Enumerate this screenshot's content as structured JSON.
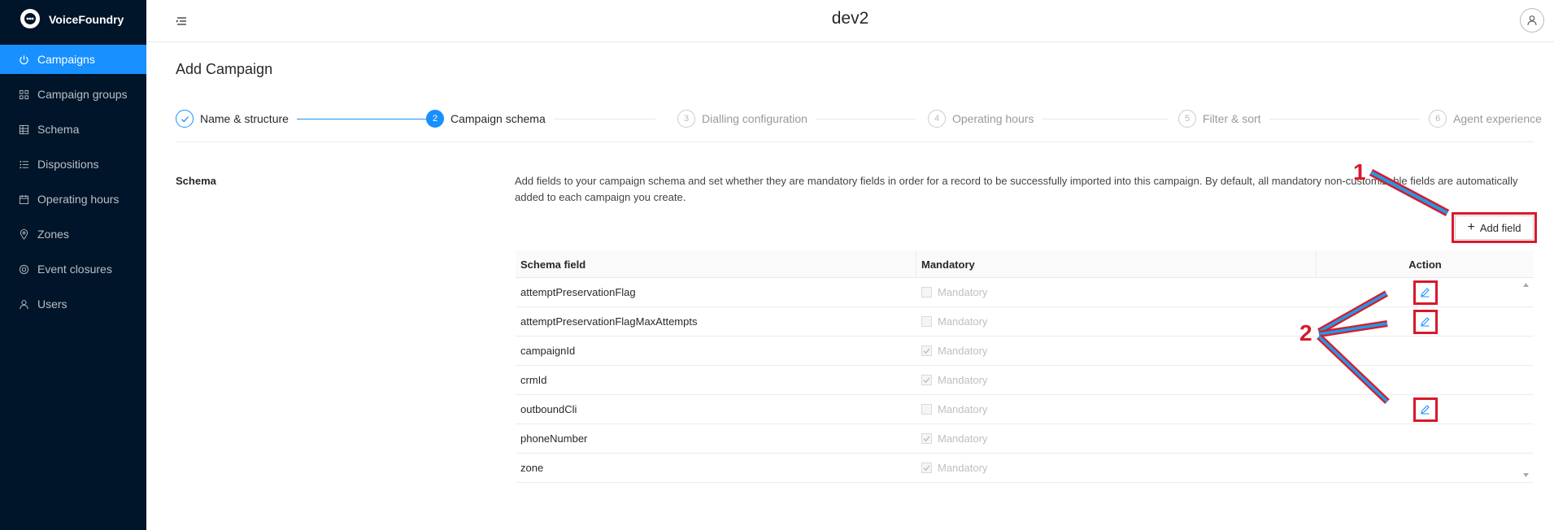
{
  "app": {
    "brand": "VoiceFoundry",
    "title": "dev2"
  },
  "sidebar": {
    "items": [
      {
        "label": "Campaigns",
        "icon": "power-icon",
        "active": true
      },
      {
        "label": "Campaign groups",
        "icon": "group-icon",
        "active": false
      },
      {
        "label": "Schema",
        "icon": "table-icon",
        "active": false
      },
      {
        "label": "Dispositions",
        "icon": "list-icon",
        "active": false
      },
      {
        "label": "Operating hours",
        "icon": "calendar-icon",
        "active": false
      },
      {
        "label": "Zones",
        "icon": "location-icon",
        "active": false
      },
      {
        "label": "Event closures",
        "icon": "target-icon",
        "active": false
      },
      {
        "label": "Users",
        "icon": "user-icon",
        "active": false
      }
    ]
  },
  "page": {
    "title": "Add Campaign"
  },
  "steps": [
    {
      "num": "1",
      "label": "Name & structure",
      "state": "done"
    },
    {
      "num": "2",
      "label": "Campaign schema",
      "state": "active"
    },
    {
      "num": "3",
      "label": "Dialling configuration",
      "state": "pending"
    },
    {
      "num": "4",
      "label": "Operating hours",
      "state": "pending"
    },
    {
      "num": "5",
      "label": "Filter & sort",
      "state": "pending"
    },
    {
      "num": "6",
      "label": "Agent experience",
      "state": "pending"
    }
  ],
  "schema": {
    "section_label": "Schema",
    "description": "Add fields to your campaign schema and set whether they are mandatory fields in order for a record to be successfully imported into this campaign. By default, all mandatory non-customizable fields are automatically added to each campaign you create.",
    "add_button": "Add field",
    "columns": [
      "Schema field",
      "Mandatory",
      "Action"
    ],
    "rows": [
      {
        "field": "attemptPreservationFlag",
        "mandatory_label": "Mandatory",
        "checked": false,
        "editable": true
      },
      {
        "field": "attemptPreservationFlagMaxAttempts",
        "mandatory_label": "Mandatory",
        "checked": false,
        "editable": true
      },
      {
        "field": "campaignId",
        "mandatory_label": "Mandatory",
        "checked": true,
        "editable": false
      },
      {
        "field": "crmId",
        "mandatory_label": "Mandatory",
        "checked": true,
        "editable": false
      },
      {
        "field": "outboundCli",
        "mandatory_label": "Mandatory",
        "checked": false,
        "editable": true
      },
      {
        "field": "phoneNumber",
        "mandatory_label": "Mandatory",
        "checked": true,
        "editable": false
      },
      {
        "field": "zone",
        "mandatory_label": "Mandatory",
        "checked": true,
        "editable": false
      }
    ]
  },
  "annotations": {
    "label_1": "1",
    "label_2": "2",
    "color": "#d9192b",
    "arrow_fill": "#1e9be8"
  },
  "colors": {
    "sidebar_bg": "#001529",
    "accent": "#1890ff"
  }
}
